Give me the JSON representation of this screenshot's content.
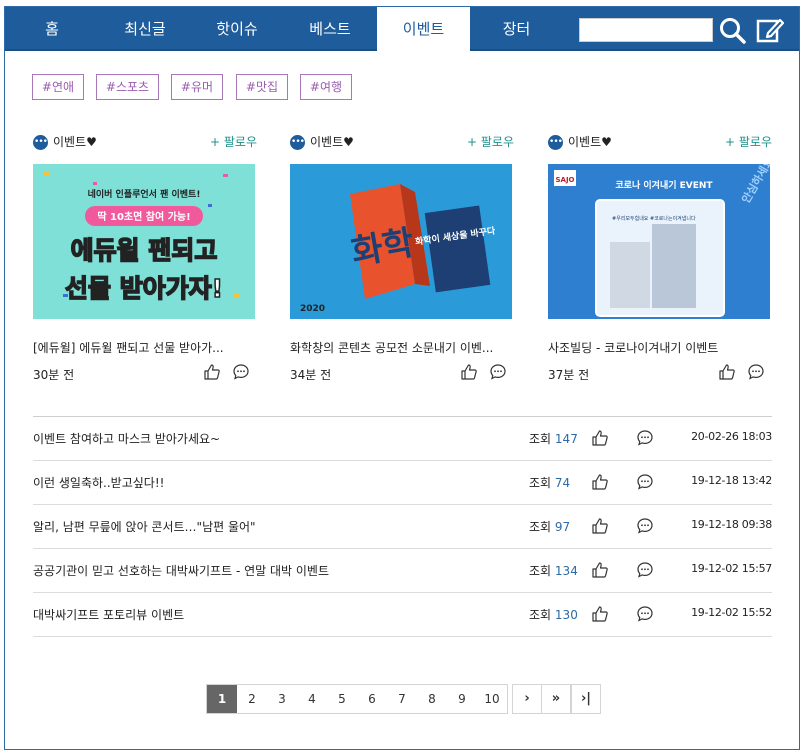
{
  "nav": {
    "tabs": [
      {
        "label": "홈"
      },
      {
        "label": "최신글"
      },
      {
        "label": "핫이슈"
      },
      {
        "label": "베스트"
      },
      {
        "label": "이벤트"
      },
      {
        "label": "장터"
      }
    ],
    "active_tab": "이벤트",
    "search": {
      "value": "",
      "placeholder": ""
    }
  },
  "tags": [
    "#연애",
    "#스포츠",
    "#유머",
    "#맛집",
    "#여행"
  ],
  "cards": [
    {
      "author": "이벤트♥",
      "follow_label": "+ 팔로우",
      "title": "[에듀윌] 에듀윌 팬되고 선물 받아가...",
      "time": "30분 전",
      "image": {
        "line1": "네이버 인플루언서 팬 이벤트!",
        "line2": "딱 10초면 참여 가능!",
        "line3": "에듀윌 팬되고",
        "line4": "선물 받아가자!"
      }
    },
    {
      "author": "이벤트♥",
      "follow_label": "+ 팔로우",
      "title": "화학창의 콘텐츠 공모전 소문내기 이벤...",
      "time": "34분 전",
      "image": {
        "big": "화학",
        "line1": "화학이 세상을 바꾸다",
        "year": "2020"
      }
    },
    {
      "author": "이벤트♥",
      "follow_label": "+ 팔로우",
      "title": "사조빌딩 - 코로나이겨내기 이벤트",
      "time": "37분 전",
      "image": {
        "logo": "SAJO",
        "line1": "코로나 이겨내기 EVENT",
        "sign": "#우리모두힘내요 #코로나는이겨냅니다",
        "side": "안심하세요 덕분에"
      }
    }
  ],
  "list": {
    "views_label": "조회",
    "rows": [
      {
        "title": "이벤트 참여하고 마스크 받아가세요~",
        "views": "147",
        "date": "20-02-26 18:03"
      },
      {
        "title": "이런 생일축하..받고싶다!!",
        "views": "74",
        "date": "19-12-18 13:42"
      },
      {
        "title": "알리, 남편 무릎에 앉아 콘서트…\"남편 울어\"",
        "views": "97",
        "date": "19-12-18 09:38"
      },
      {
        "title": "공공기관이 믿고 선호하는 대박싸기프트 - 연말 대박 이벤트",
        "views": "134",
        "date": "19-12-02 15:57"
      },
      {
        "title": "대박싸기프트 포토리뷰 이벤트",
        "views": "130",
        "date": "19-12-02 15:52"
      }
    ]
  },
  "pagination": {
    "pages": [
      "1",
      "2",
      "3",
      "4",
      "5",
      "6",
      "7",
      "8",
      "9",
      "10"
    ],
    "current": "1",
    "next": "›",
    "next_group": "»",
    "last": "›|"
  },
  "colors": {
    "nav": "#1e5c9b",
    "tag": "#9a5cb0",
    "follow": "#1f8f8a",
    "views_num": "#2d6aa6"
  }
}
